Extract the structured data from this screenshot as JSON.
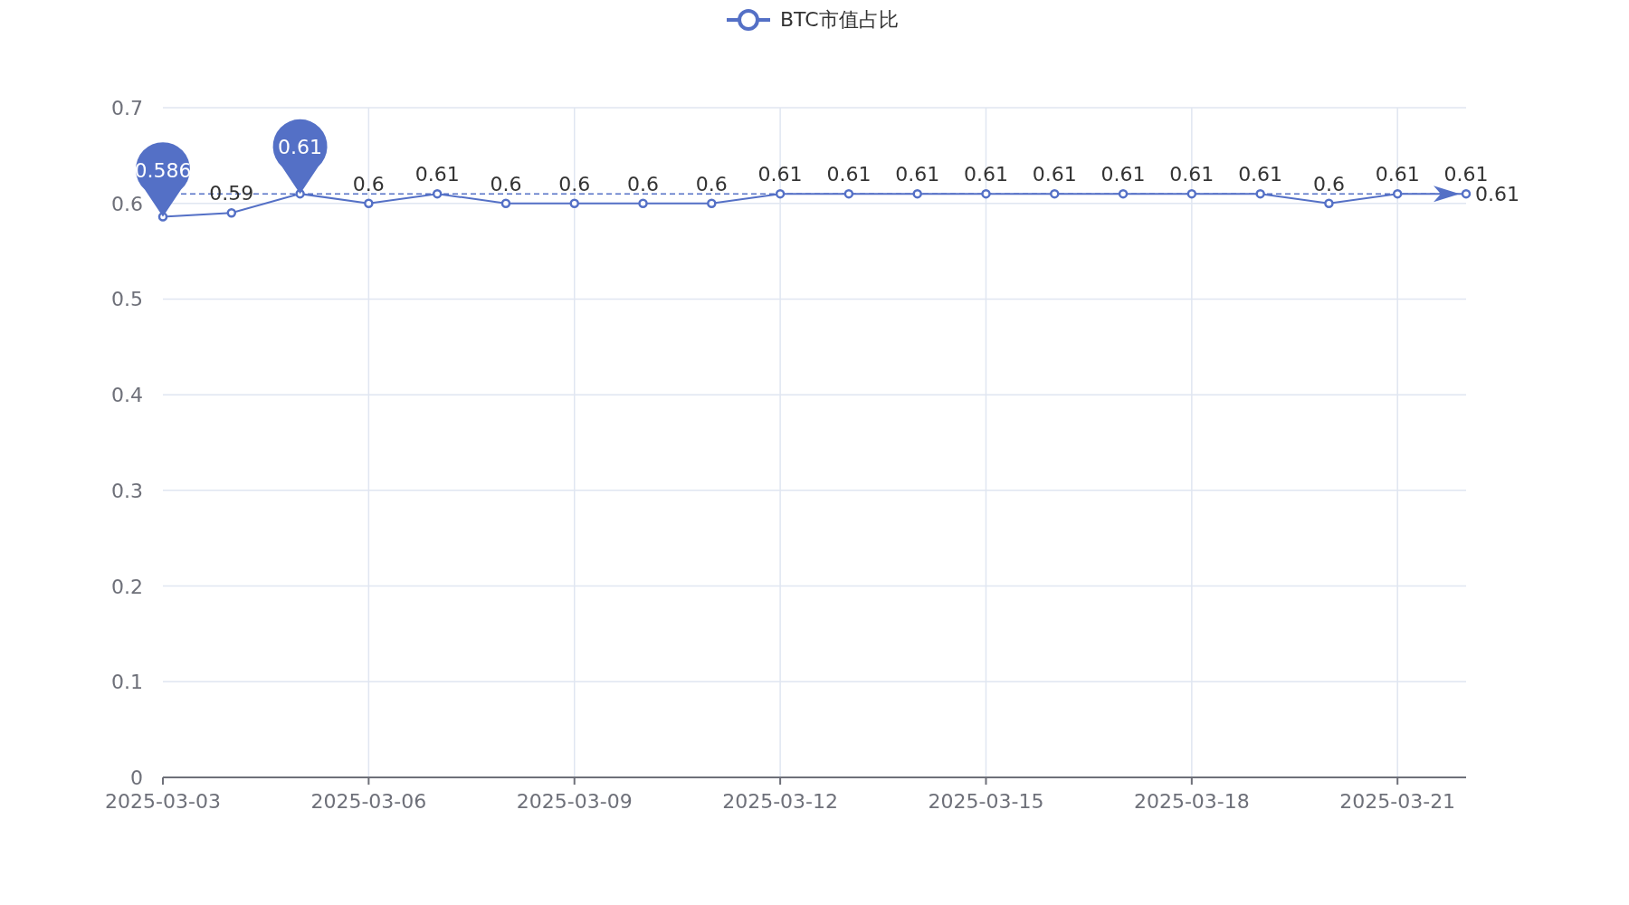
{
  "chart_data": {
    "type": "line",
    "categories": [
      "2025-03-03",
      null,
      null,
      "2025-03-06",
      null,
      null,
      "2025-03-09",
      null,
      null,
      "2025-03-12",
      null,
      null,
      "2025-03-15",
      null,
      null,
      "2025-03-18",
      null,
      null,
      "2025-03-21",
      null
    ],
    "ylim": [
      0,
      0.7
    ],
    "yticks": [
      0,
      0.1,
      0.2,
      0.3,
      0.4,
      0.5,
      0.6,
      0.7
    ],
    "grid": true,
    "series": [
      {
        "name": "BTC市值占比",
        "color": "#5470c6",
        "marker": "o",
        "values": [
          0.586,
          0.59,
          0.61,
          0.6,
          0.61,
          0.6,
          0.6,
          0.6,
          0.6,
          0.61,
          0.61,
          0.61,
          0.61,
          0.61,
          0.61,
          0.61,
          0.61,
          0.6,
          0.61,
          0.61
        ]
      }
    ],
    "value_labels": [
      null,
      "0.59",
      null,
      "0.6",
      "0.61",
      "0.6",
      "0.6",
      "0.6",
      "0.6",
      "0.61",
      "0.61",
      "0.61",
      "0.61",
      "0.61",
      "0.61",
      "0.61",
      "0.61",
      "0.6",
      "0.61",
      "0.61"
    ],
    "annotations": [
      {
        "text": "0.586",
        "y": 0.586
      },
      {
        "text": "0.61",
        "y": 0.61
      }
    ],
    "ref_lines": [
      {
        "axis": "y",
        "value": 0.61,
        "label": "0.61"
      }
    ]
  }
}
